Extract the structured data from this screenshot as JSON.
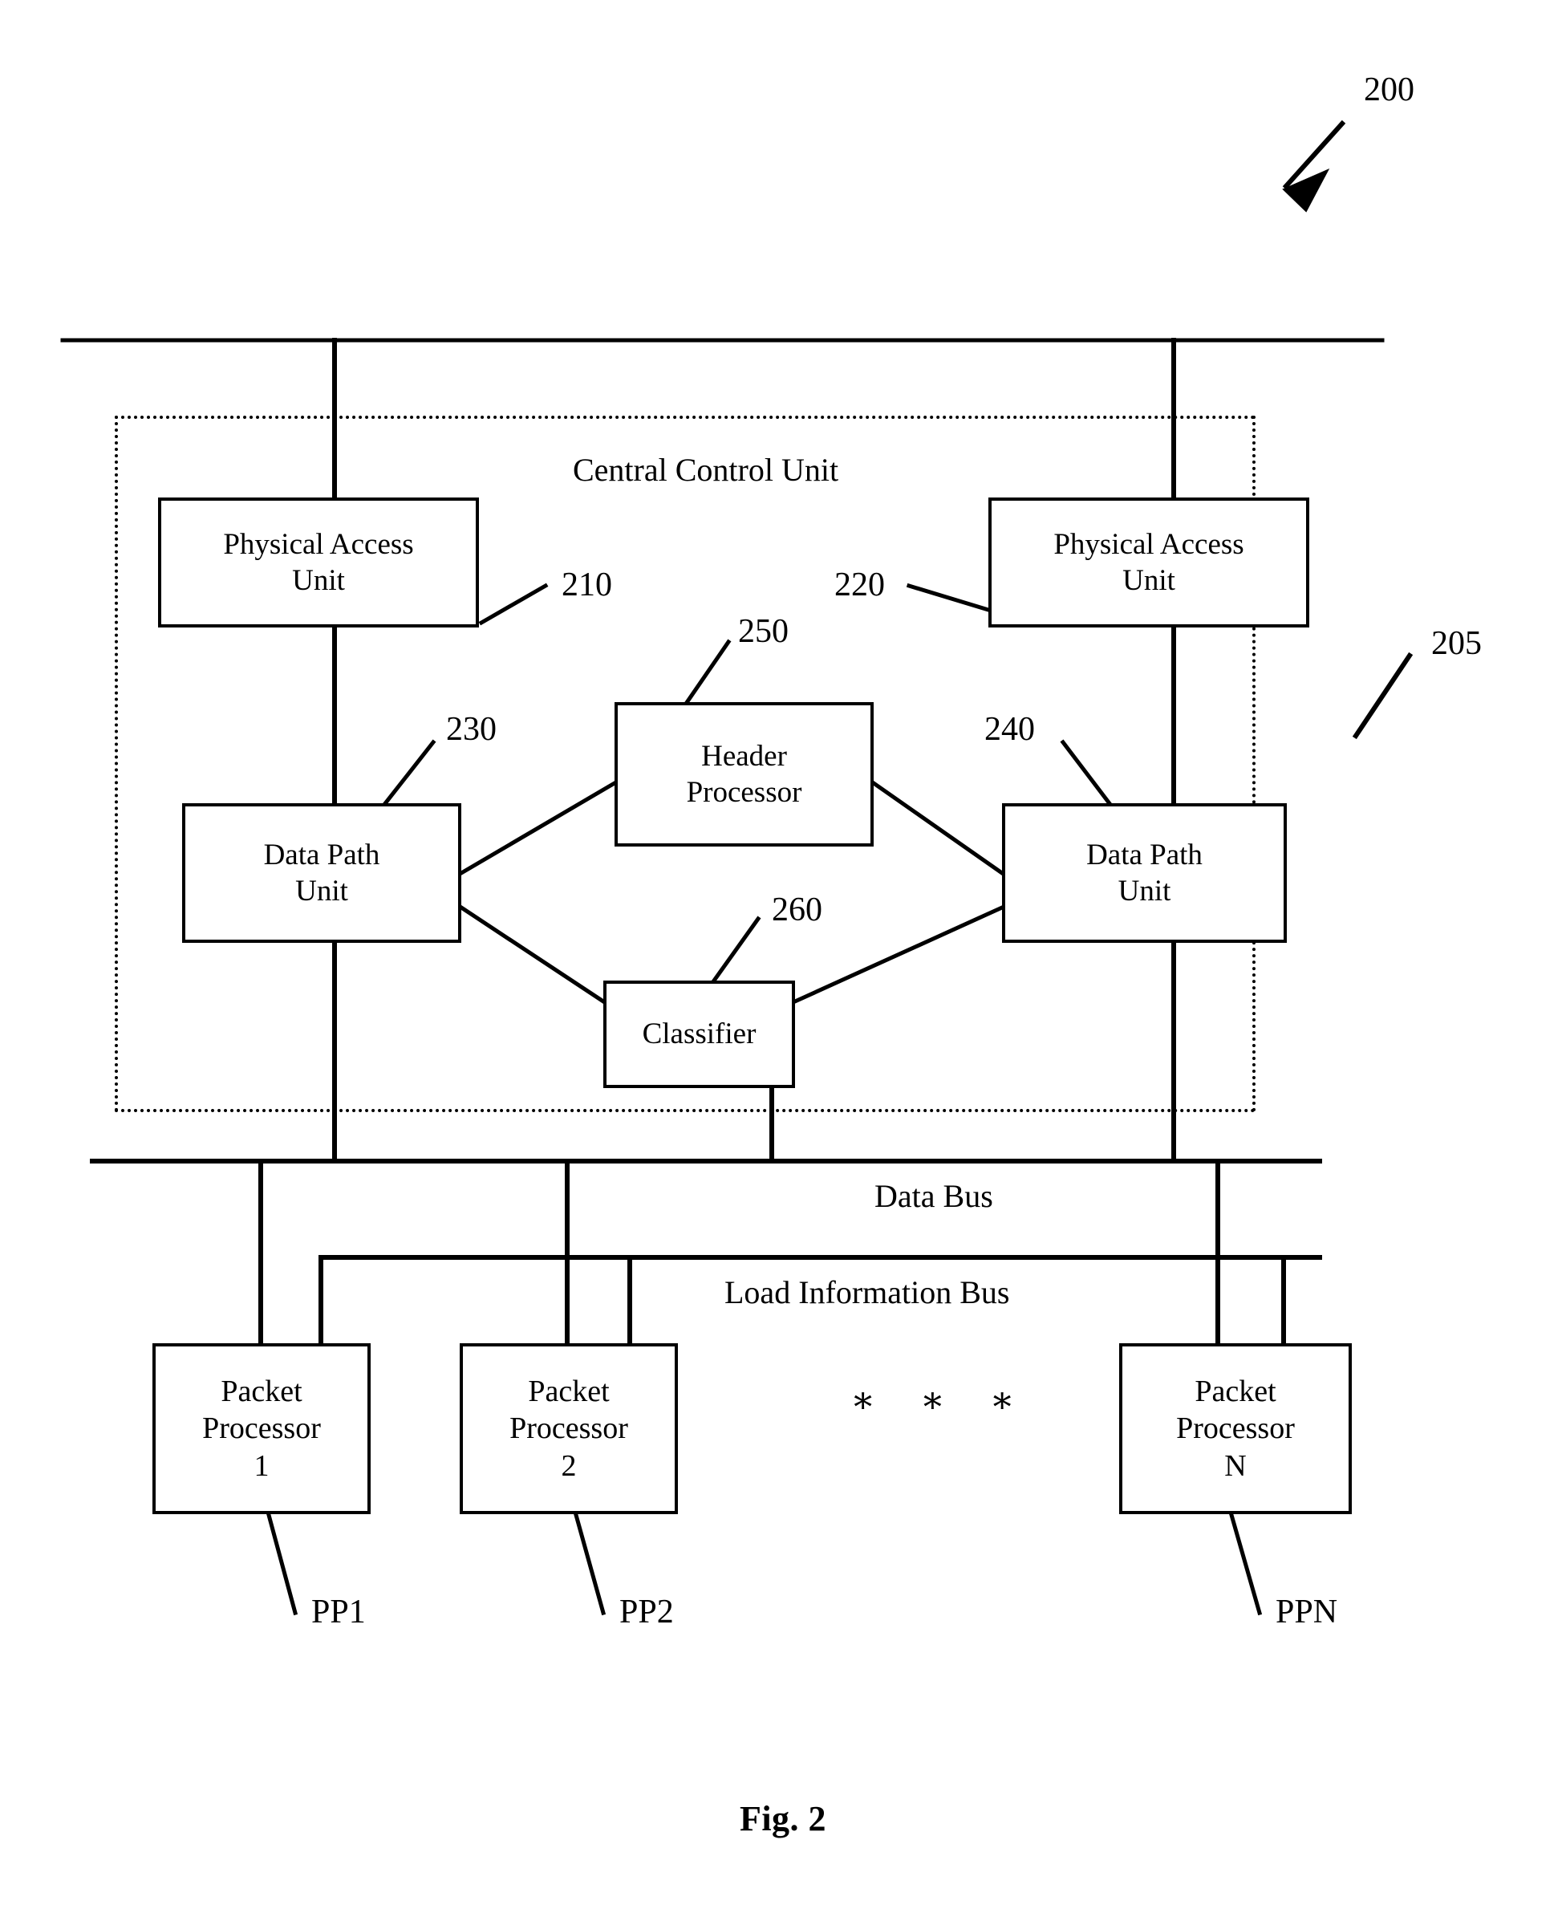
{
  "figure": {
    "caption": "Fig. 2",
    "system_ref": "200",
    "enclosure_ref": "205",
    "enclosure_title": "Central Control Unit"
  },
  "blocks": {
    "physical_access_unit_left": {
      "line1": "Physical Access",
      "line2": "Unit",
      "ref": "210"
    },
    "physical_access_unit_right": {
      "line1": "Physical Access",
      "line2": "Unit",
      "ref": "220"
    },
    "data_path_unit_left": {
      "line1": "Data Path",
      "line2": "Unit",
      "ref": "230"
    },
    "data_path_unit_right": {
      "line1": "Data Path",
      "line2": "Unit",
      "ref": "240"
    },
    "header_processor": {
      "line1": "Header",
      "line2": "Processor",
      "ref": "250"
    },
    "classifier": {
      "line1": "Classifier",
      "line2": "",
      "ref": "260"
    }
  },
  "buses": {
    "data_bus": "Data Bus",
    "load_information_bus": "Load Information Bus"
  },
  "packet_processors": [
    {
      "line1": "Packet",
      "line2": "Processor",
      "line3": "1",
      "ref": "PP1"
    },
    {
      "line1": "Packet",
      "line2": "Processor",
      "line3": "2",
      "ref": "PP2"
    },
    {
      "line1": "Packet",
      "line2": "Processor",
      "line3": "N",
      "ref": "PPN"
    }
  ],
  "ellipsis": "∗ ∗ ∗",
  "colors": {
    "ink": "#000000",
    "paper": "#ffffff"
  }
}
